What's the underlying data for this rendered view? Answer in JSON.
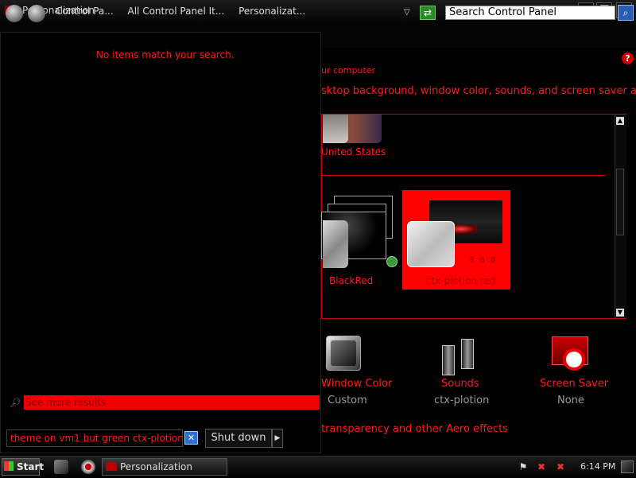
{
  "window": {
    "title": "Personalization"
  },
  "titlebar": {
    "minimize": "—",
    "restore": "❐",
    "close": "✕"
  },
  "address": {
    "crumbs": [
      "Control Pa...",
      "All Control Panel It...",
      "Personalizat..."
    ],
    "dropdown": "▽",
    "refresh": "⇄",
    "search_value": "Search Control Panel",
    "search_icon": "⌕"
  },
  "content": {
    "help": "?",
    "subtitle": "ur computer",
    "description": "sktop background, window color, sounds, and screen saver all at",
    "themes": {
      "top_label": "United States",
      "blackred_label": "BlackRed",
      "selected_label": "ctx-plotion red",
      "selected_dots": "8 6 8"
    },
    "bottom_links": [
      {
        "title": "Window Color",
        "subtitle": "Custom"
      },
      {
        "title": "Sounds",
        "subtitle": "ctx-plotion"
      },
      {
        "title": "Screen Saver",
        "subtitle": "None"
      }
    ],
    "aero_link": "transparency and other Aero effects"
  },
  "startmenu": {
    "no_items": "No items match your search.",
    "see_more": "See more results",
    "search_text": "theme on vm1 but green ctx-plotion",
    "clear": "✕",
    "shutdown": "Shut down",
    "shutdown_arrow": "▶"
  },
  "taskbar": {
    "start_label": "Start",
    "task_label": "Personalization",
    "clock": "6:14 PM"
  },
  "colors": {
    "accent": "#ff1a1a",
    "selected_theme": "#ff0000",
    "background": "#000000"
  }
}
